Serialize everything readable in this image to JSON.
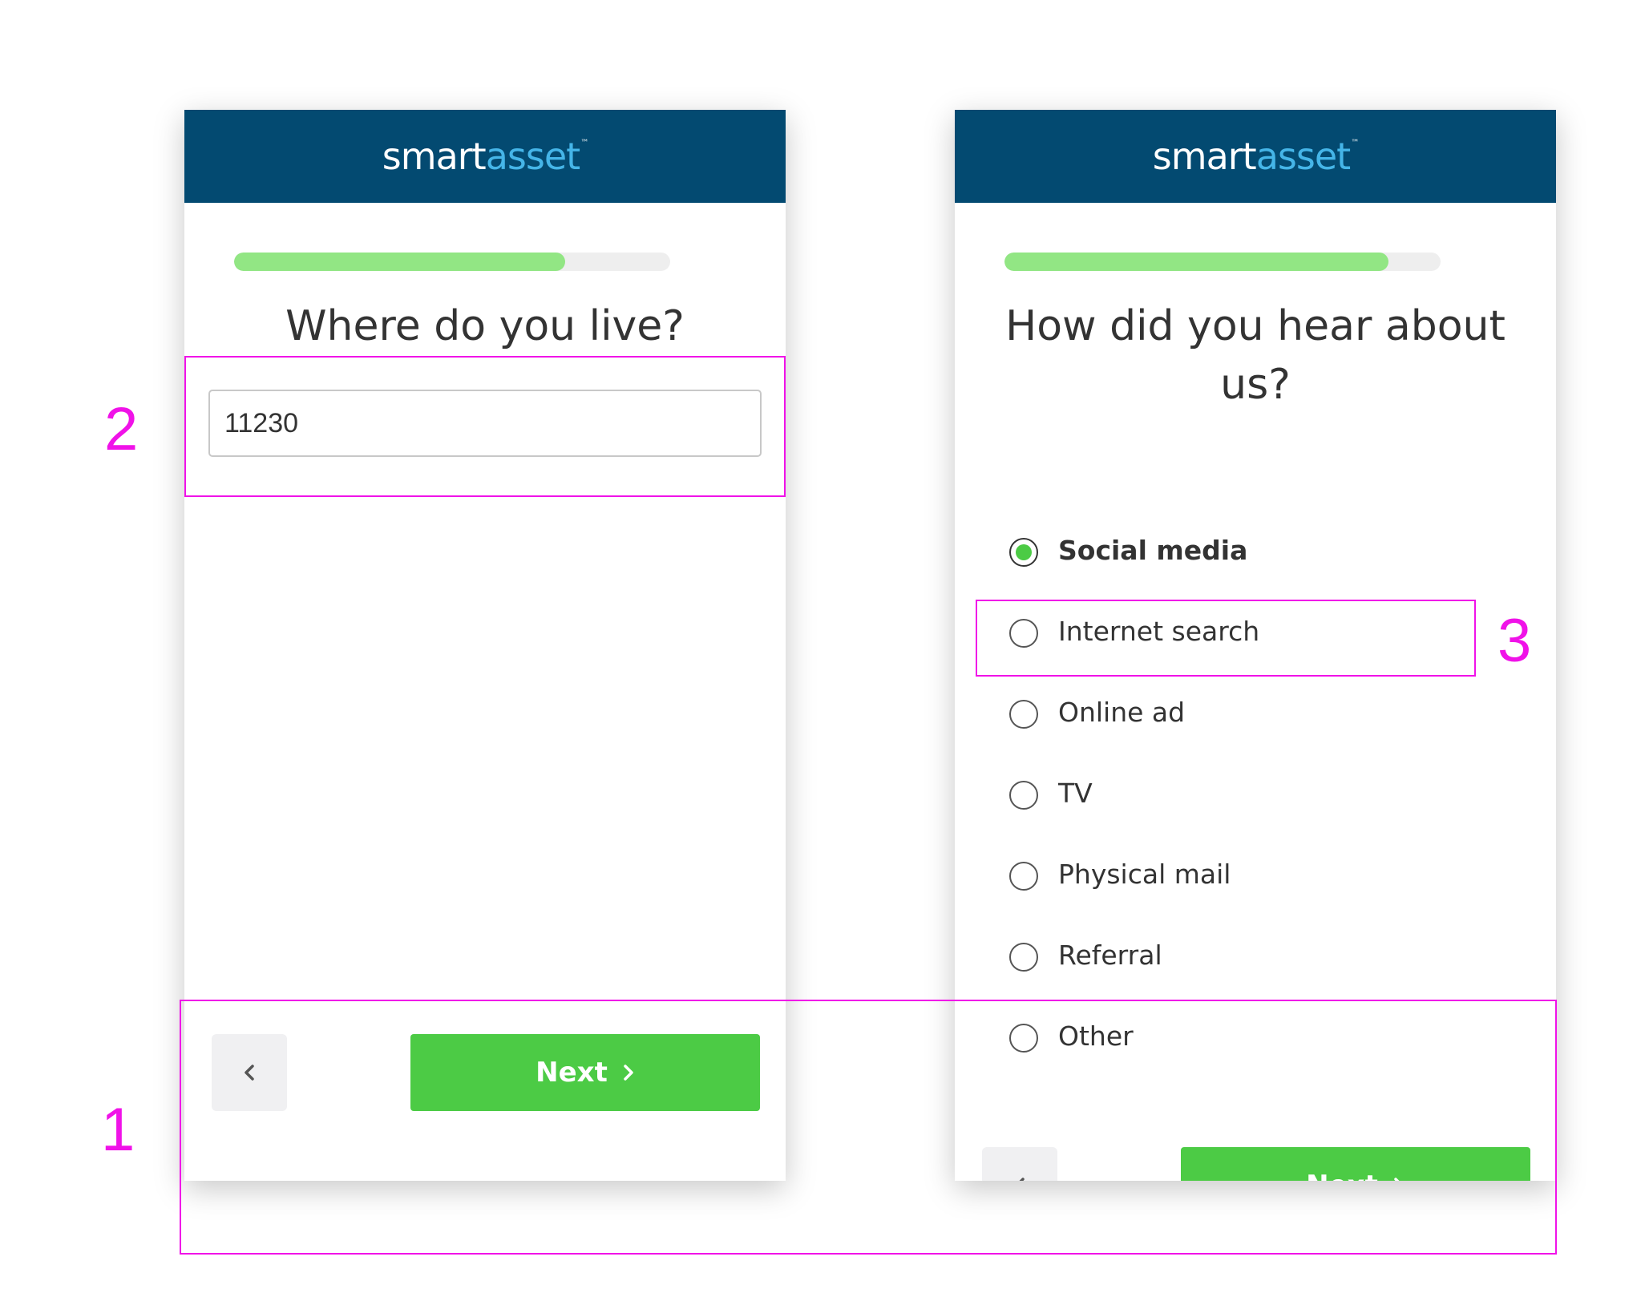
{
  "colors": {
    "header_bg": "#034a71",
    "brand_white": "#ffffff",
    "brand_blue": "#45b5e8",
    "progress_fill": "#92e684",
    "progress_track": "#eeeeee",
    "primary_button": "#4ccb45",
    "annotation": "#f012e8"
  },
  "logo": {
    "part1": "smart",
    "part2": "asset",
    "tm": "™"
  },
  "screen_left": {
    "progress": 0.76,
    "question": "Where do you live?",
    "zip_value": "11230",
    "footer": {
      "back_icon": "chevron-left-icon",
      "next_label": "Next",
      "next_icon": "chevron-right-icon"
    }
  },
  "screen_right": {
    "progress": 0.88,
    "question": "How did you hear about us?",
    "options": [
      {
        "label": "Social media",
        "selected": true
      },
      {
        "label": "Internet search",
        "selected": false
      },
      {
        "label": "Online ad",
        "selected": false
      },
      {
        "label": "TV",
        "selected": false
      },
      {
        "label": "Physical mail",
        "selected": false
      },
      {
        "label": "Referral",
        "selected": false
      },
      {
        "label": "Other",
        "selected": false
      }
    ],
    "footer": {
      "back_icon": "chevron-left-icon",
      "next_label": "Next",
      "next_icon": "chevron-right-icon"
    }
  },
  "annotations": [
    {
      "number": "1"
    },
    {
      "number": "2"
    },
    {
      "number": "3"
    }
  ]
}
